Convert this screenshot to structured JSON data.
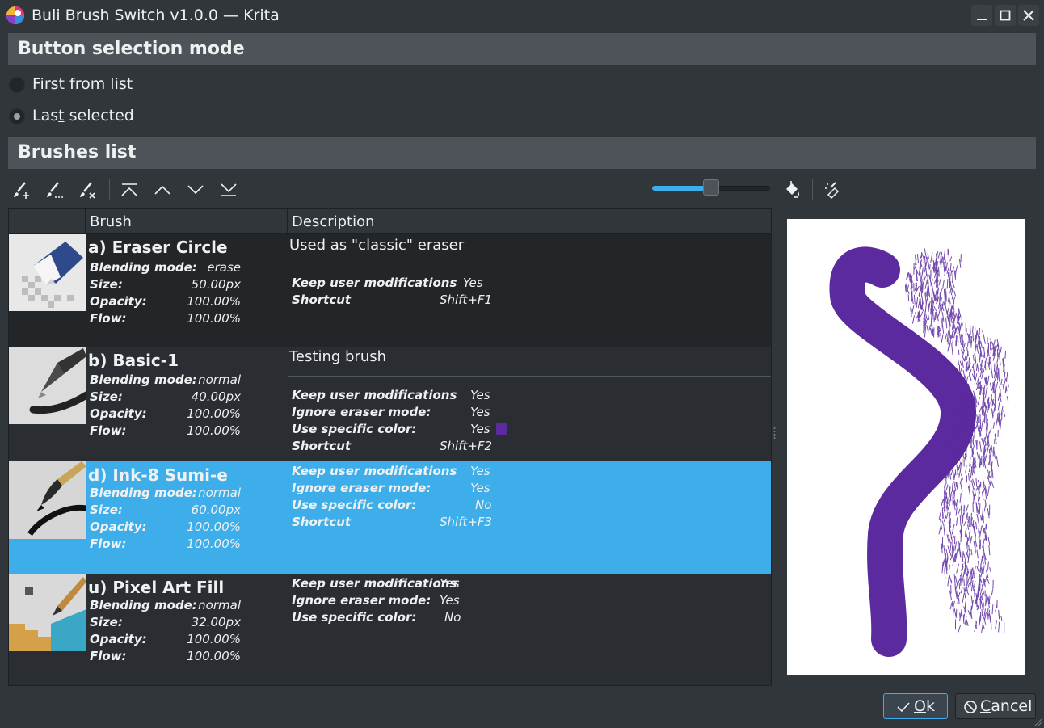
{
  "window": {
    "title": "Buli Brush Switch v1.0.0 — Krita",
    "controls": [
      "minimize",
      "maximize",
      "close"
    ]
  },
  "selection_mode": {
    "header": "Button selection mode",
    "options": [
      {
        "label_pre": "First from ",
        "label_mnemonic": "l",
        "label_post": "ist",
        "selected": false
      },
      {
        "label_pre": "Las",
        "label_mnemonic": "t",
        "label_post": " selected",
        "selected": true
      }
    ]
  },
  "brushes": {
    "header": "Brushes list",
    "toolbar": {
      "icons": [
        "add-brush-icon",
        "edit-brush-icon",
        "remove-brush-icon",
        "move-first-icon",
        "move-up-icon",
        "move-down-icon",
        "move-last-icon",
        "fill-icon",
        "eraser-settings-icon"
      ],
      "thumbnail_size_fraction": 0.5
    },
    "columns": [
      "Brush",
      "Description"
    ],
    "items": [
      {
        "name": "a) Eraser Circle",
        "blending_label": "Blending mode:",
        "blending": "erase",
        "size_label": "Size:",
        "size": "50.00px",
        "opacity_label": "Opacity:",
        "opacity": "100.00%",
        "flow_label": "Flow:",
        "flow": "100.00%",
        "description": "Used as \"classic\" eraser",
        "options": [
          {
            "key": "Keep user modifications",
            "value": "Yes"
          },
          {
            "key": "Shortcut",
            "value": "Shift+F1"
          }
        ]
      },
      {
        "name": "b) Basic-1",
        "blending_label": "Blending mode:",
        "blending": "normal",
        "size_label": "Size:",
        "size": "40.00px",
        "opacity_label": "Opacity:",
        "opacity": "100.00%",
        "flow_label": "Flow:",
        "flow": "100.00%",
        "description": "Testing brush",
        "options": [
          {
            "key": "Keep user modifications",
            "value": "Yes"
          },
          {
            "key": "Ignore eraser mode:",
            "value": "Yes"
          },
          {
            "key": "Use specific color:",
            "value": "Yes"
          },
          {
            "key": "Shortcut",
            "value": "Shift+F2"
          }
        ],
        "color": "#5b2a9e"
      },
      {
        "name": "d) Ink-8 Sumi-e",
        "blending_label": "Blending mode:",
        "blending": "normal",
        "size_label": "Size:",
        "size": "60.00px",
        "opacity_label": "Opacity:",
        "opacity": "100.00%",
        "flow_label": "Flow:",
        "flow": "100.00%",
        "description": "",
        "options": [
          {
            "key": "Keep user modifications",
            "value": "Yes"
          },
          {
            "key": "Ignore eraser mode:",
            "value": "Yes"
          },
          {
            "key": "Use specific color:",
            "value": "No"
          },
          {
            "key": "Shortcut",
            "value": "Shift+F3"
          }
        ],
        "selected": true
      },
      {
        "name": "u) Pixel Art Fill",
        "blending_label": "Blending mode:",
        "blending": "normal",
        "size_label": "Size:",
        "size": "32.00px",
        "opacity_label": "Opacity:",
        "opacity": "100.00%",
        "flow_label": "Flow:",
        "flow": "100.00%",
        "description": "",
        "options": [
          {
            "key": "Keep user modifications",
            "value": "Yes"
          },
          {
            "key": "Ignore eraser mode:",
            "value": "Yes"
          },
          {
            "key": "Use specific color:",
            "value": "No"
          }
        ]
      }
    ]
  },
  "buttons": {
    "ok_mnemonic": "O",
    "ok_rest": "k",
    "cancel_mnemonic": "C",
    "cancel_rest": "ancel"
  },
  "colors": {
    "accent": "#3daee9",
    "stroke": "#5b2a9e"
  }
}
